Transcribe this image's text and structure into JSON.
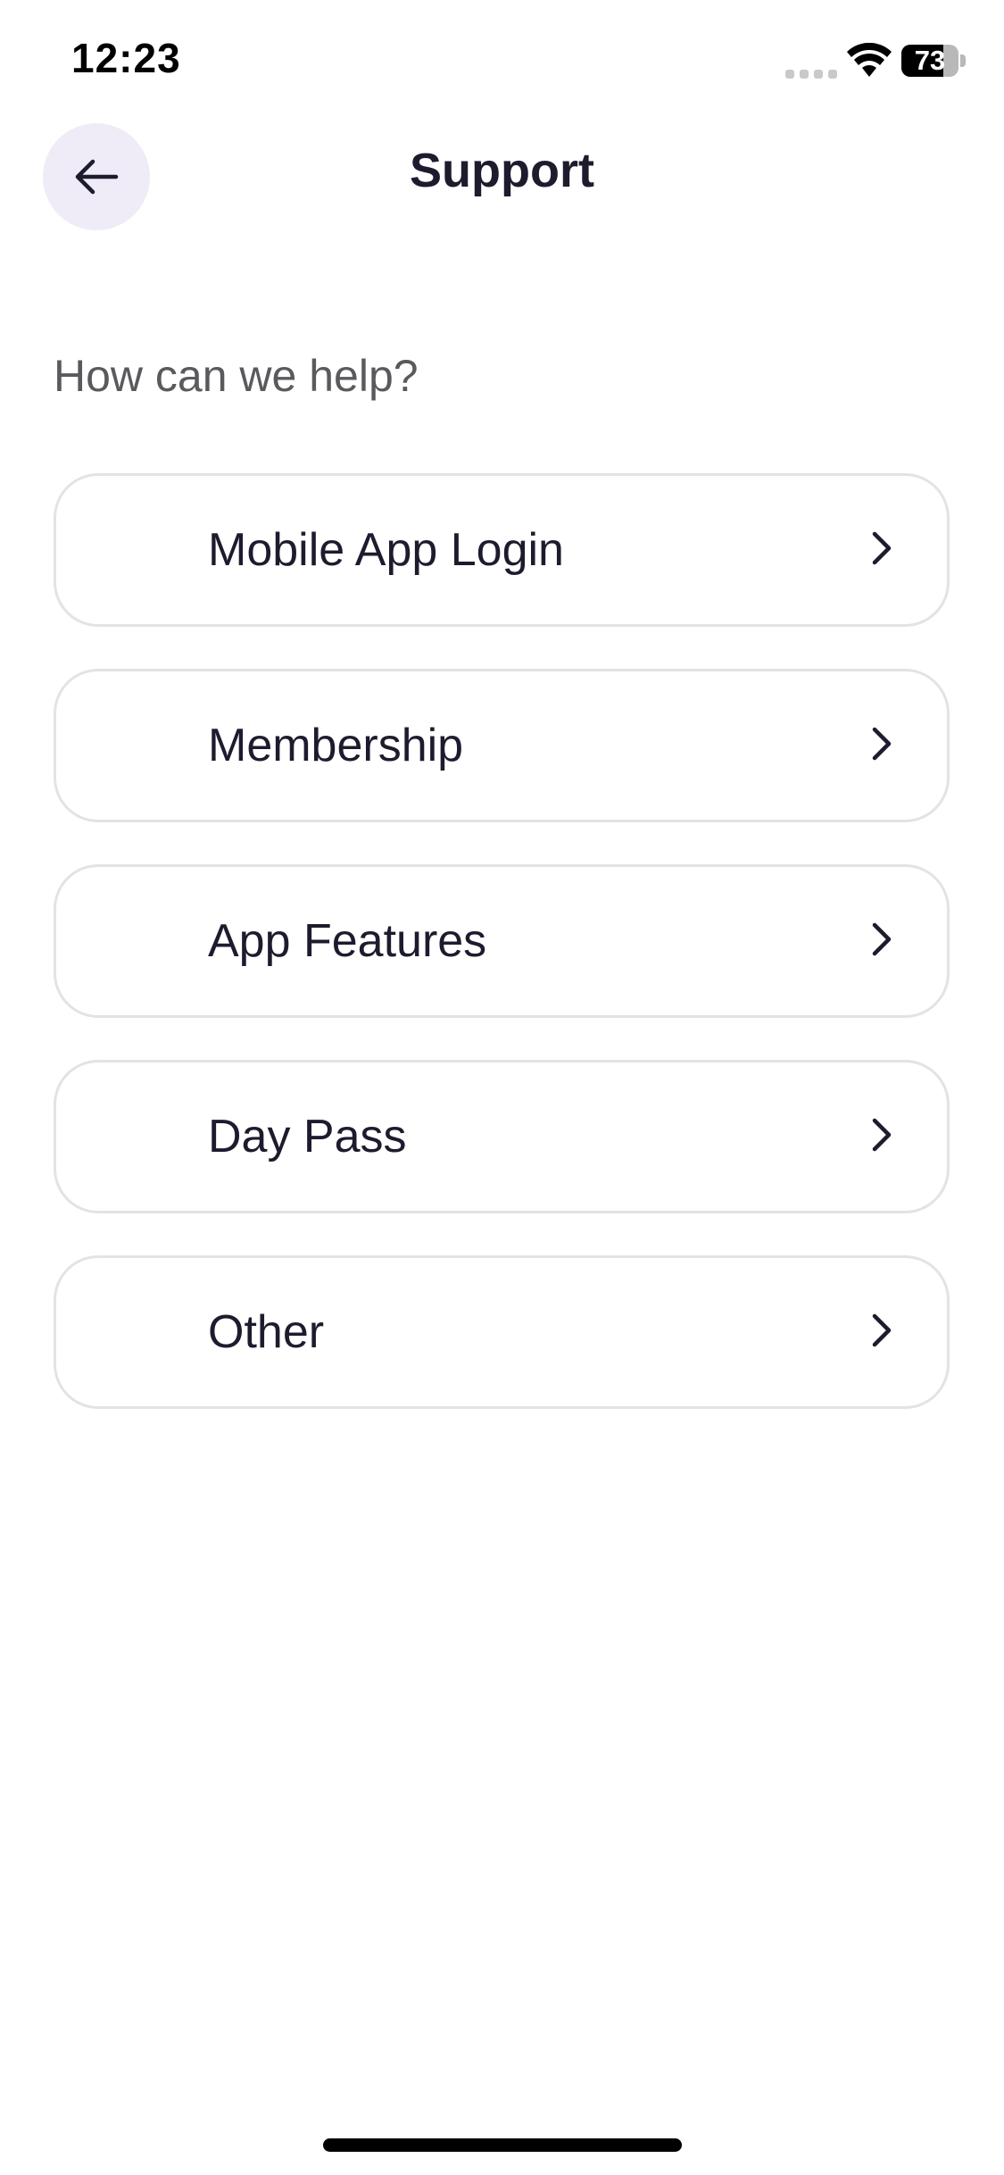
{
  "status_bar": {
    "time": "12:23",
    "battery_level": "73",
    "battery_fraction": 0.73
  },
  "header": {
    "title": "Support",
    "back_icon": "arrow-left-icon"
  },
  "prompt": "How can we help?",
  "topics": [
    {
      "label": "Mobile App Login",
      "icon": "chevron-right-icon"
    },
    {
      "label": "Membership",
      "icon": "chevron-right-icon"
    },
    {
      "label": "App Features",
      "icon": "chevron-right-icon"
    },
    {
      "label": "Day Pass",
      "icon": "chevron-right-icon"
    },
    {
      "label": "Other",
      "icon": "chevron-right-icon"
    }
  ],
  "colors": {
    "text_primary": "#1d1c2e",
    "text_secondary": "#5a5a5e",
    "back_button_bg": "#efecf7",
    "card_border": "#e3e3e6"
  }
}
